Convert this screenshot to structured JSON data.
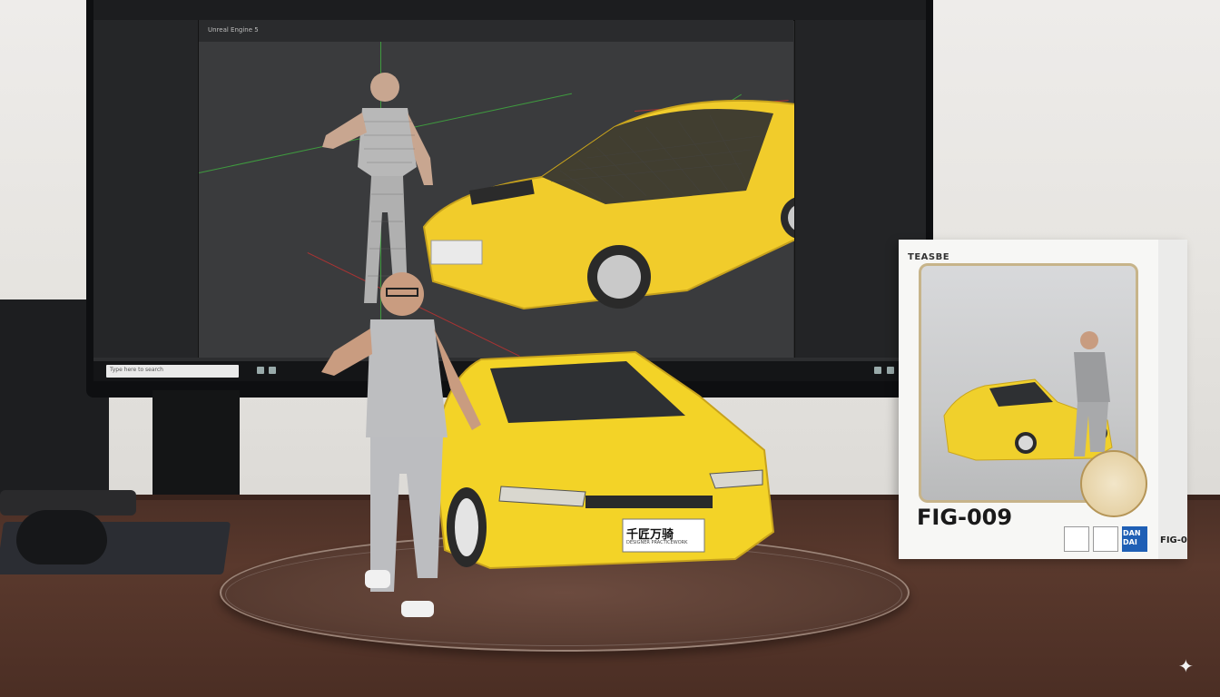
{
  "scene": {
    "description_tag": "Desktop photo with 3D modeling software on monitor, yellow car model, figure and retail box"
  },
  "screen": {
    "viewport_header": "Unreal Engine 5",
    "taskbar_search": "Type here to search"
  },
  "car_plate": {
    "line1": "千匠万骑",
    "line2": "DESIGNER PRACTICEWORK"
  },
  "box": {
    "brand": "TEASBE",
    "code": "FIG-009",
    "publisher_logo": "DAN\nDAI",
    "side_label": "FIG-0"
  },
  "icons": [
    "sparkle-icon",
    "mouse",
    "box-icons"
  ],
  "colors": {
    "car_yellow": "#f2d22b",
    "desk": "#4f3229",
    "ui_dark": "#2d2e30",
    "box_gold": "#c7b48a"
  }
}
